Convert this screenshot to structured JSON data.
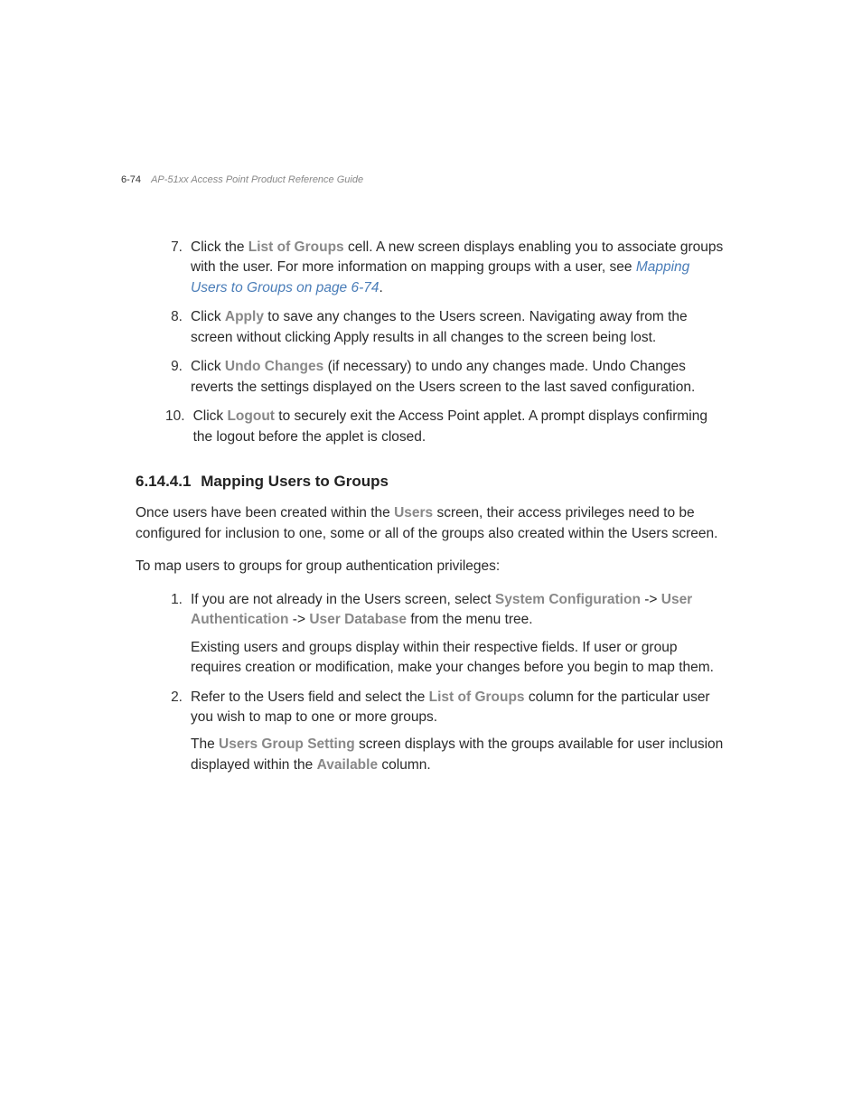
{
  "header": {
    "pageNumber": "6-74",
    "title": "AP-51xx Access Point Product Reference Guide"
  },
  "steps": [
    {
      "number": "7.",
      "pre": "Click the ",
      "bold1": "List of Groups",
      "mid": " cell. A new screen displays enabling you to associate groups with the user. For more information on mapping groups with a user, see ",
      "link": "Mapping Users to Groups on page 6-74",
      "post": "."
    },
    {
      "number": "8.",
      "pre": "Click ",
      "bold1": "Apply",
      "mid": " to save any changes to the Users screen. Navigating away from the screen without clicking Apply results in all changes to the screen being lost.",
      "link": "",
      "post": ""
    },
    {
      "number": "9.",
      "pre": "Click ",
      "bold1": "Undo Changes",
      "mid": " (if necessary) to undo any changes made. Undo Changes reverts the settings displayed on the Users screen to the last saved configuration.",
      "link": "",
      "post": ""
    },
    {
      "number": "10.",
      "pre": "Click ",
      "bold1": "Logout",
      "mid": " to securely exit the Access Point applet. A prompt displays confirming the logout before the applet is closed.",
      "link": "",
      "post": ""
    }
  ],
  "section": {
    "number": "6.14.4.1",
    "title": "Mapping Users to Groups"
  },
  "para1": {
    "pre": "Once users have been created within the ",
    "bold": "Users",
    "post": " screen, their access privileges need to be configured for inclusion to one, some or all of the groups also created within the Users screen."
  },
  "para2": "To map users to groups for group authentication privileges:",
  "steps2": [
    {
      "number": "1.",
      "line1_pre": "If you are not already in the Users screen, select ",
      "line1_b1": "System Configuration",
      "line1_mid1": " -> ",
      "line1_b2": "User Authentication",
      "line1_mid2": " -> ",
      "line1_b3": "User Database",
      "line1_post": " from the menu tree.",
      "line2": "Existing users and groups display within their respective fields. If user or group requires creation or modification, make your changes before you begin to map them."
    },
    {
      "number": "2.",
      "line1_pre": "Refer to the Users field and select the ",
      "line1_b1": "List of Groups",
      "line1_post": " column for the particular user you wish to map to one or more groups.",
      "line2_pre": "The ",
      "line2_b1": "Users Group Setting",
      "line2_mid": " screen displays with the groups available for user inclusion displayed within the ",
      "line2_b2": "Available",
      "line2_post": " column."
    }
  ]
}
